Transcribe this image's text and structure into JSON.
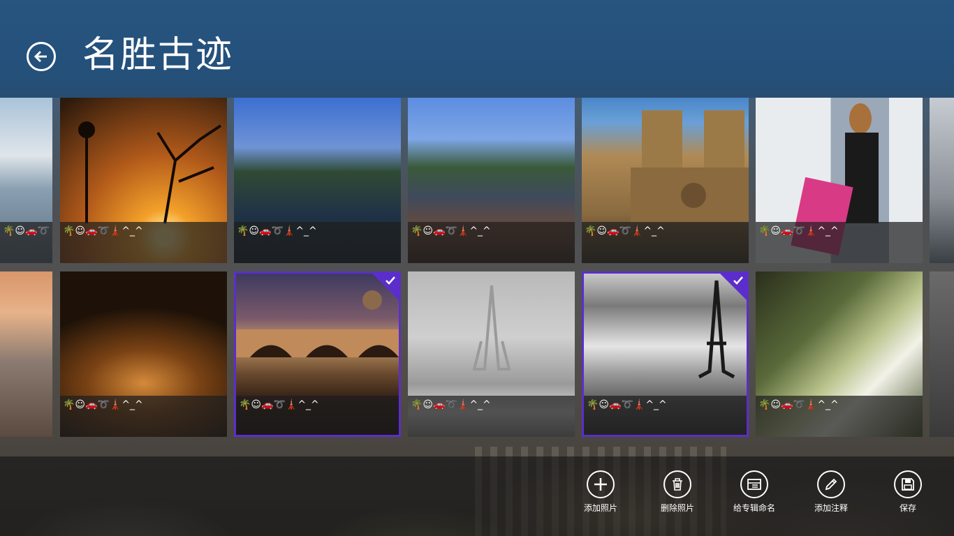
{
  "header": {
    "title": "名胜古迹"
  },
  "caption_text": "🌴☺🚗➰🗼^_^",
  "row1": [
    {
      "name": "lake-skyline",
      "caption": "🌴☺🚗➰🗼^_^",
      "selected": false
    },
    {
      "name": "sunset-lamppost",
      "caption": "🌴☺🚗➰🗼^_^",
      "selected": false
    },
    {
      "name": "canal-night",
      "caption": "🌴☺🚗➰🗼^_^",
      "selected": false
    },
    {
      "name": "canal-evening",
      "caption": "🌴☺🚗➰🗼^_^",
      "selected": false
    },
    {
      "name": "notre-dame",
      "caption": "🌴☺🚗➰🗼^_^",
      "selected": false
    },
    {
      "name": "pop-art-bag",
      "caption": "🌴☺🚗➰🗼^_^",
      "selected": false
    }
  ],
  "row2": [
    {
      "name": "city-dusk",
      "caption": "",
      "selected": false
    },
    {
      "name": "night-city",
      "caption": "🌴☺🚗➰🗼^_^",
      "selected": false
    },
    {
      "name": "bridge-night",
      "caption": "🌴☺🚗➰🗼^_^",
      "selected": true
    },
    {
      "name": "foggy-tower",
      "caption": "🌴☺🚗➰🗼^_^",
      "selected": false
    },
    {
      "name": "eiffel-tower",
      "caption": "🌴☺🚗➰🗼^_^",
      "selected": true
    },
    {
      "name": "green-architecture",
      "caption": "🌴☺🚗➰🗼^_^",
      "selected": false
    }
  ],
  "appbar": {
    "add_photo": "添加照片",
    "delete_photo": "删除照片",
    "name_album": "给专辑命名",
    "add_note": "添加注释",
    "save": "保存"
  },
  "colors": {
    "selection": "#5b2ecb",
    "header_bg": "#27557f"
  }
}
